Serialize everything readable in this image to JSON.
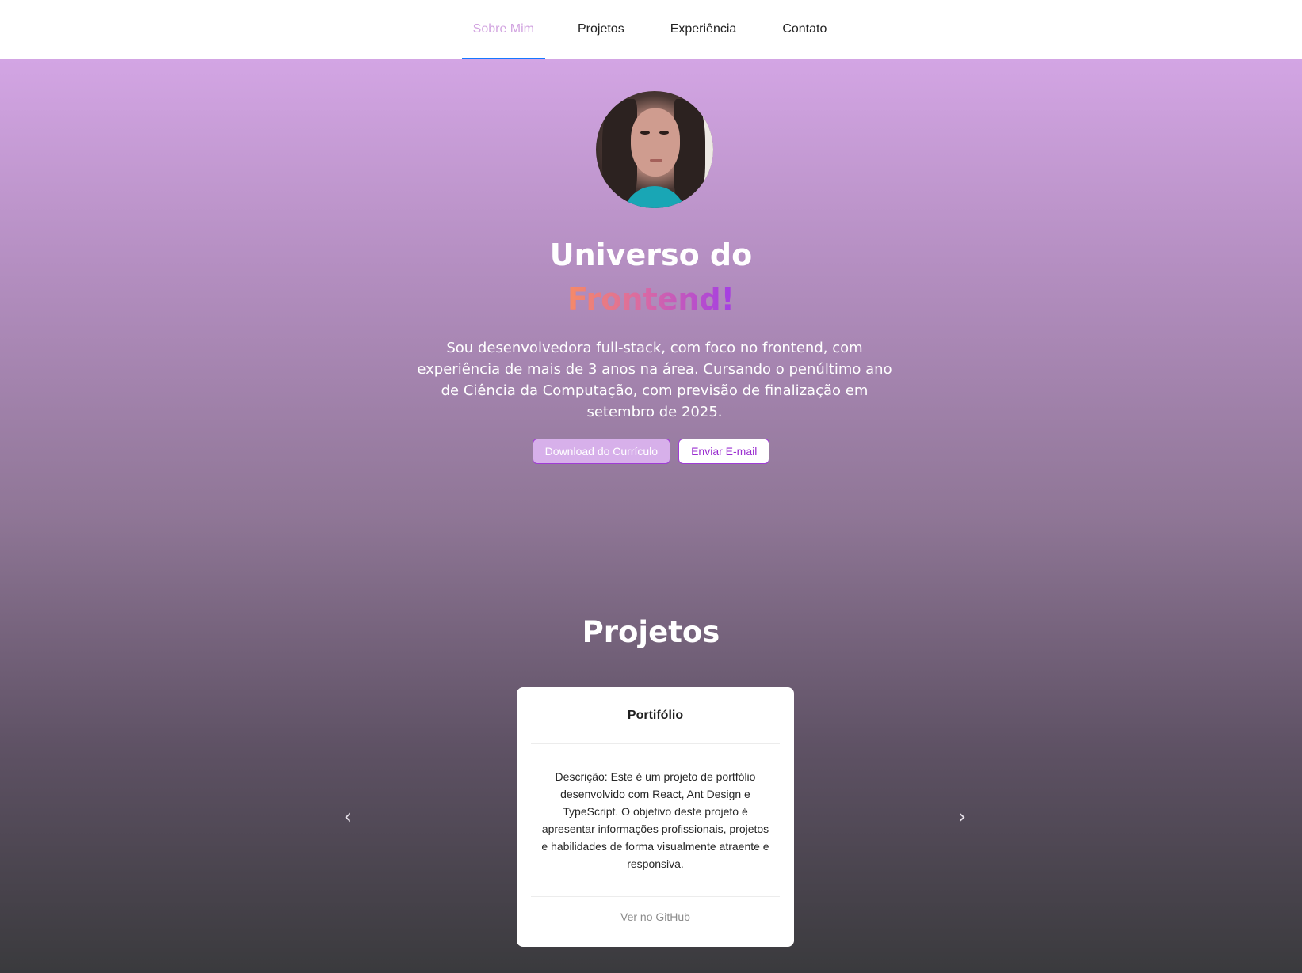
{
  "nav": {
    "items": [
      {
        "label": "Sobre Mim",
        "active": true
      },
      {
        "label": "Projetos",
        "active": false
      },
      {
        "label": "Experiência",
        "active": false
      },
      {
        "label": "Contato",
        "active": false
      }
    ]
  },
  "hero": {
    "title_line1": "Universo do",
    "title_line2": "Frontend!",
    "intro": "Sou desenvolvedora full-stack, com foco no frontend, com experiência de mais de 3 anos na área. Cursando o penúltimo ano de Ciência da Computação, com previsão de finalização em setembro de 2025.",
    "download_button": "Download do Currículo",
    "email_button": "Enviar E-mail"
  },
  "projects": {
    "section_title": "Projetos",
    "card": {
      "title": "Portifólio",
      "description": "Descrição: Este é um projeto de portfólio desenvolvido com React, Ant Design e TypeScript. O objetivo deste projeto é apresentar informações profissionais, projetos e habilidades de forma visualmente atraente e responsiva.",
      "footer_link": "Ver no GitHub"
    },
    "prev_icon": "chevron-left-icon",
    "next_icon": "chevron-right-icon"
  },
  "colors": {
    "accent": "#a03cd6",
    "nav_active": "#d2a4e0",
    "nav_underline": "#1677ff",
    "gradient_start": "#f68a66",
    "gradient_end": "#a23de6"
  }
}
